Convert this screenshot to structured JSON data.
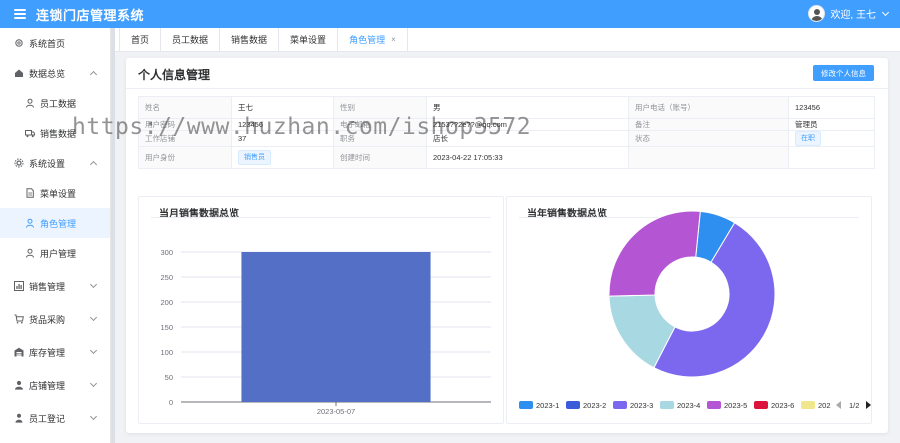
{
  "header": {
    "app_title": "连锁门店管理系统",
    "welcome": "欢迎, 王七"
  },
  "sidebar": {
    "items": [
      {
        "label": "系统首页",
        "icon": "gear-icon"
      },
      {
        "label": "数据总览",
        "icon": "home-icon"
      },
      {
        "label": "员工数据",
        "icon": "user-icon"
      },
      {
        "label": "销售数据",
        "icon": "truck-icon"
      },
      {
        "label": "系统设置",
        "icon": "settings-icon"
      },
      {
        "label": "菜单设置",
        "icon": "document-icon"
      },
      {
        "label": "角色管理",
        "icon": "user-icon"
      },
      {
        "label": "用户管理",
        "icon": "user-icon"
      },
      {
        "label": "销售管理",
        "icon": "chart-icon"
      },
      {
        "label": "货品采购",
        "icon": "cart-icon"
      },
      {
        "label": "库存管理",
        "icon": "warehouse-icon"
      },
      {
        "label": "店铺管理",
        "icon": "people-icon"
      },
      {
        "label": "员工登记",
        "icon": "person-icon"
      }
    ]
  },
  "tabs": [
    {
      "label": "首页"
    },
    {
      "label": "员工数据"
    },
    {
      "label": "销售数据"
    },
    {
      "label": "菜单设置"
    },
    {
      "label": "角色管理",
      "close": "×"
    }
  ],
  "card": {
    "title": "个人信息管理",
    "edit_button": "修改个人信息"
  },
  "info": {
    "name_label": "姓名",
    "name_value": "王七",
    "gender_label": "性别",
    "gender_value": "男",
    "phone_label": "用户电话（账号）",
    "phone_value": "123456",
    "password_label": "用户密码",
    "password_value": "123456",
    "email_label": "电子邮箱",
    "email_value": "2153??2e??@qq.com",
    "remark_label": "备注",
    "remark_value": "管理员",
    "store_label": "工作店铺",
    "store_value": "37",
    "position_label": "职务",
    "position_value": "店长",
    "status_label": "状态",
    "status_value": "在职",
    "identity_label": "用户身份",
    "identity_value": "销售员",
    "created_label": "创建时间",
    "created_value": "2023-04-22 17:05:33"
  },
  "watermark": "https://www.huzhan.com/ishop3572",
  "chart_data": [
    {
      "type": "bar",
      "title": "当月销售数据总览",
      "categories": [
        "2023-05-07"
      ],
      "values": [
        300
      ],
      "ylim": [
        0,
        300
      ],
      "yticks": [
        0,
        50,
        100,
        150,
        200,
        250,
        300
      ],
      "grid": true,
      "colors": {
        "bar": "#5470c6"
      }
    },
    {
      "type": "pie",
      "title": "当年销售数据总览",
      "donut": true,
      "legend_position": "bottom",
      "legend_page": "1/2",
      "labels": [
        "2023-1",
        "2023-2",
        "2023-3",
        "2023-4",
        "2023-5",
        "2023-6",
        "202"
      ],
      "colors": [
        "#2f8ff0",
        "#3b5cd8",
        "#7b68ee",
        "#a8d8e2",
        "#b456d4",
        "#dc143c",
        "#f0e68c"
      ],
      "values": [
        7,
        0,
        49,
        17,
        27,
        0,
        0
      ]
    }
  ]
}
